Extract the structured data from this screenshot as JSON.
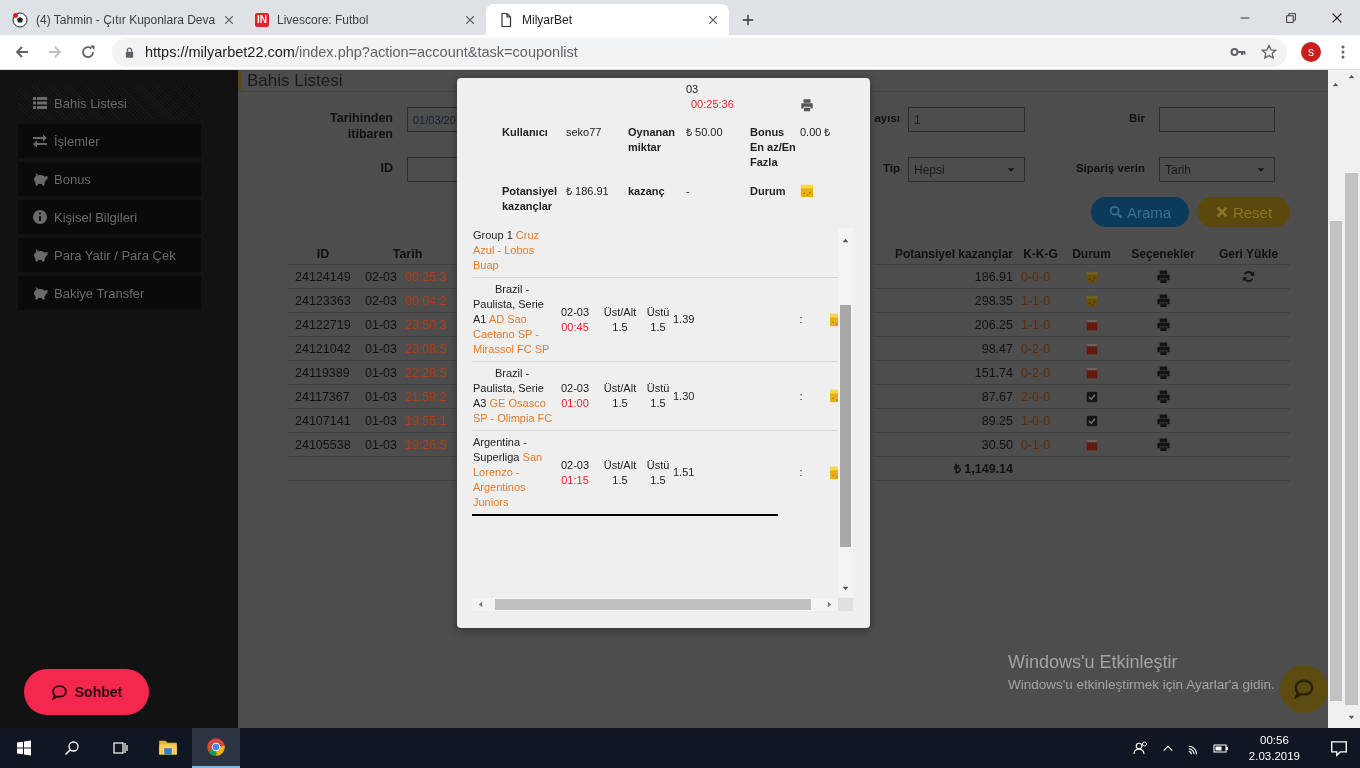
{
  "browser": {
    "tabs": [
      {
        "title": "(4) Tahmin - Çıtır Kuponlara Deva",
        "selected": false
      },
      {
        "title": "Livescore: Futbol",
        "favicon_text": "IN",
        "selected": false
      },
      {
        "title": "MilyarBet",
        "selected": true
      }
    ],
    "forward_disabled": true,
    "url": {
      "host": "https://milyarbet22.com",
      "path": "/index.php?action=account&task=couponlist"
    },
    "profile_initial": "s"
  },
  "sidebar": {
    "items": [
      {
        "label": "Bahis Listesi",
        "selected": true
      },
      {
        "label": "İşlemler",
        "selected": false
      },
      {
        "label": "Bonus",
        "selected": false
      },
      {
        "label": "Kişisel Bilgileri",
        "selected": false
      },
      {
        "label": "Para Yatir / Para Çek",
        "selected": false
      },
      {
        "label": "Bakiye Transfer",
        "selected": false
      }
    ],
    "chat_button": "Sohbet"
  },
  "page": {
    "title": "Bahis Listesi",
    "filters_left": [
      {
        "label": "Tarihinden itibaren",
        "kind": "input",
        "value": "01/03/20"
      },
      {
        "label": "ID",
        "kind": "input"
      }
    ],
    "filters_right": [
      {
        "label": "ayısı",
        "kind": "input",
        "value": "1"
      },
      {
        "label": "Bir",
        "kind": "input"
      },
      {
        "label": "Tip",
        "kind": "select",
        "value": "Hepsi"
      },
      {
        "label": "Sipariş verin",
        "kind": "select",
        "value": "Tarih"
      }
    ],
    "buttons": [
      {
        "label": "Arama",
        "kind": "search"
      },
      {
        "label": "Reset",
        "kind": "reset"
      }
    ],
    "table": {
      "columns_left": [
        "ID",
        "Tarih"
      ],
      "columns_right": [
        "Potansiyel kazançlar",
        "K-K-G",
        "Durum",
        "Seçenekler",
        "Geri Yükle"
      ],
      "rows": [
        {
          "id": "24124149",
          "date": "02-03",
          "time": "00:25:3",
          "potential": "186.91",
          "kkg": "0-0-0",
          "kind": "pending",
          "reload": true
        },
        {
          "id": "24123363",
          "date": "02-03",
          "time": "00:04:2",
          "potential": "298.35",
          "kkg": "1-1-0",
          "kind": "pending",
          "reload": false
        },
        {
          "id": "24122719",
          "date": "01-03",
          "time": "23:50:3",
          "potential": "206.25",
          "kkg": "1-1-0",
          "kind": "lost",
          "reload": false
        },
        {
          "id": "24121042",
          "date": "01-03",
          "time": "23:08:5",
          "potential": "98.47",
          "kkg": "0-2-0",
          "kind": "lost",
          "reload": false
        },
        {
          "id": "24119389",
          "date": "01-03",
          "time": "22:28:5",
          "potential": "151.74",
          "kkg": "0-2-0",
          "kind": "lost",
          "reload": false
        },
        {
          "id": "24117367",
          "date": "01-03",
          "time": "21:59:2",
          "potential": "87.67",
          "kkg": "2-0-0",
          "kind": "won",
          "reload": false
        },
        {
          "id": "24107141",
          "date": "01-03",
          "time": "19:55:1",
          "potential": "89.25",
          "kkg": "1-0-0",
          "kind": "won",
          "reload": false
        },
        {
          "id": "24105538",
          "date": "01-03",
          "time": "19:26:5",
          "potential": "30.50",
          "kkg": "0-1-0",
          "kind": "lost",
          "reload": false
        }
      ],
      "total": "₺ 1,149.14"
    }
  },
  "modal": {
    "header": {
      "date": "03",
      "time": "00:25:36"
    },
    "info": [
      {
        "label": "Kullanıcı",
        "kind": "text",
        "value": "seko77"
      },
      {
        "label": "Oynanan miktar",
        "kind": "text",
        "value": "₺ 50.00"
      },
      {
        "label": "Bonus En az/En Fazla",
        "kind": "text",
        "value": "0.00 ₺"
      },
      {
        "label": "Potansiyel kazançlar",
        "kind": "text",
        "value": "₺ 186.91"
      },
      {
        "label": "kazanç",
        "kind": "text",
        "value": "-"
      },
      {
        "label": "Durum",
        "kind": "pending"
      }
    ],
    "selections": [
      {
        "league": "Group 1",
        "teams": "Cruz Azul - Lobos Buap"
      },
      {
        "league": "Brazil - Paulista, Serie A1",
        "teams": "AD Sao Caetano SP - Mirassol FC SP",
        "date": "02-03",
        "time": "00:45",
        "market": "Üst/Alt",
        "market_line": "1.5",
        "pick": "Üstü",
        "pick_line": "1.5",
        "odds": "1.39",
        "score": ":",
        "kind": "pending"
      },
      {
        "league": "Brazil - Paulista, Serie A3",
        "teams": "GE Osasco SP - Olimpia FC",
        "date": "02-03",
        "time": "01:00",
        "market": "Üst/Alt",
        "market_line": "1.5",
        "pick": "Üstü",
        "pick_line": "1.5",
        "odds": "1.30",
        "score": ":",
        "kind": "pending"
      },
      {
        "league": "Argentina - Superliga",
        "teams": "San Lorenzo - Argentinos Juniors",
        "date": "02-03",
        "time": "01:15",
        "market": "Üst/Alt",
        "market_line": "1.5",
        "pick": "Üstü",
        "pick_line": "1.5",
        "odds": "1.51",
        "score": ":",
        "kind": "pending"
      }
    ]
  },
  "os_notice": {
    "title": "Windows'u Etkinleştir",
    "text": "Windows'u etkinleştirmek için Ayarlar'a gidin."
  },
  "taskbar": {
    "apps": [
      {
        "kind": "explorer",
        "active": false
      },
      {
        "kind": "chrome",
        "active": true
      }
    ],
    "clock": {
      "time": "00:56",
      "date": "2.03.2019"
    }
  }
}
